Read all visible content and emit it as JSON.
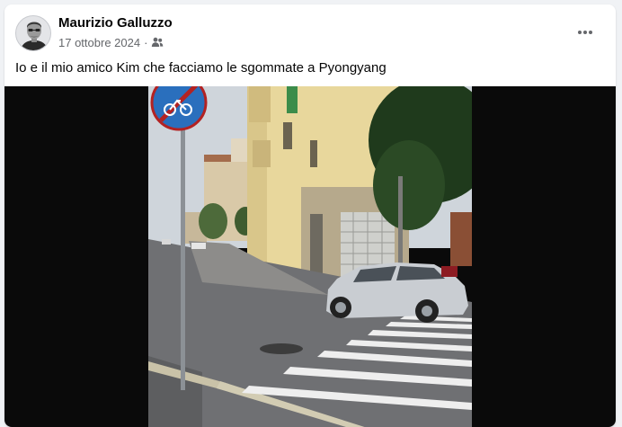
{
  "post": {
    "author_name": "Maurizio Galluzzo",
    "date": "17 ottobre 2024",
    "separator": "·",
    "audience_icon": "friends-icon",
    "more_icon": "ellipsis-icon",
    "caption": "Io e il mio amico Kim che facciamo le sgommate a Pyongyang",
    "media_type": "video"
  },
  "colors": {
    "page_bg": "#f0f2f5",
    "card_bg": "#ffffff",
    "text_primary": "#050505",
    "text_secondary": "#65676b",
    "media_bg": "#0a0a0a"
  }
}
